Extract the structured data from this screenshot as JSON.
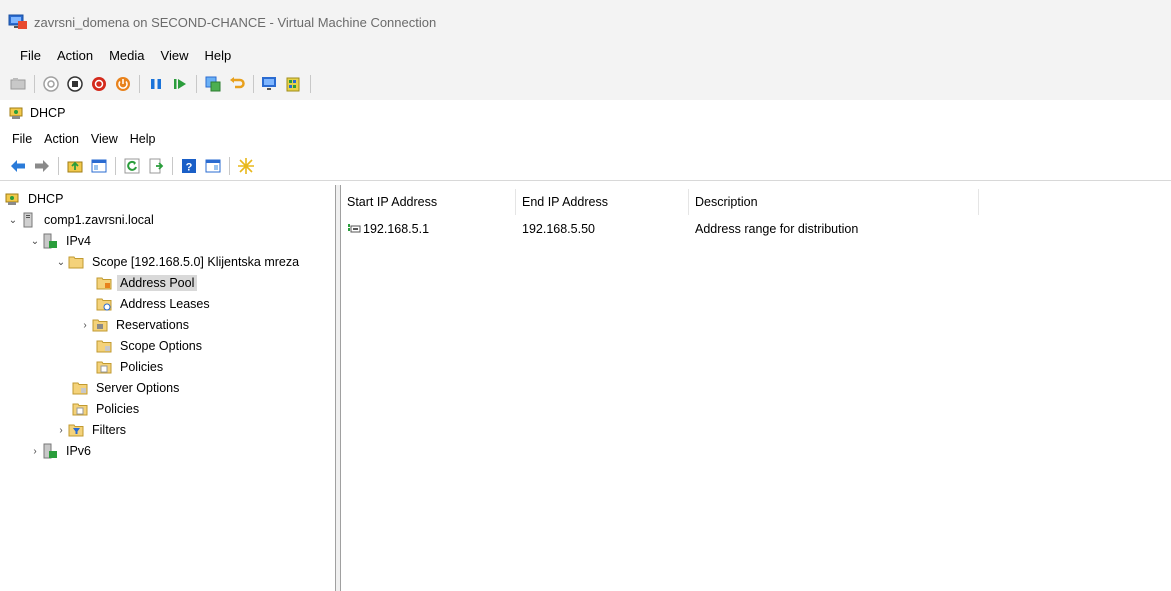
{
  "vm_window": {
    "title": "zavrsni_domena on SECOND-CHANCE - Virtual Machine Connection",
    "menu": [
      "File",
      "Action",
      "Media",
      "View",
      "Help"
    ],
    "toolbar_icons": [
      "ctrl-alt-del-icon",
      "start-icon",
      "turn-off-icon",
      "shutdown-icon",
      "power-icon",
      "pause-icon",
      "resume-icon",
      "checkpoint-icon",
      "revert-icon",
      "enhanced-session-icon",
      "share-icon"
    ]
  },
  "mmc": {
    "title": "DHCP",
    "menu": [
      "File",
      "Action",
      "View",
      "Help"
    ],
    "toolbar_icons": [
      "back-icon",
      "forward-icon",
      "up-folder-icon",
      "show-hide-tree-icon",
      "refresh-icon",
      "export-list-icon",
      "help-icon",
      "show-hide-action-pane-icon",
      "new-star-icon"
    ]
  },
  "tree": {
    "root": "DHCP",
    "server": "comp1.zavrsni.local",
    "ipv4": "IPv4",
    "scope": "Scope [192.168.5.0] Klijentska mreza",
    "address_pool": "Address Pool",
    "address_leases": "Address Leases",
    "reservations": "Reservations",
    "scope_options": "Scope Options",
    "scope_policies": "Policies",
    "server_options": "Server Options",
    "policies": "Policies",
    "filters": "Filters",
    "ipv6": "IPv6"
  },
  "list": {
    "columns": [
      "Start IP Address",
      "End IP Address",
      "Description"
    ],
    "rows": [
      {
        "start": "192.168.5.1",
        "end": "192.168.5.50",
        "description": "Address range for distribution"
      }
    ]
  }
}
